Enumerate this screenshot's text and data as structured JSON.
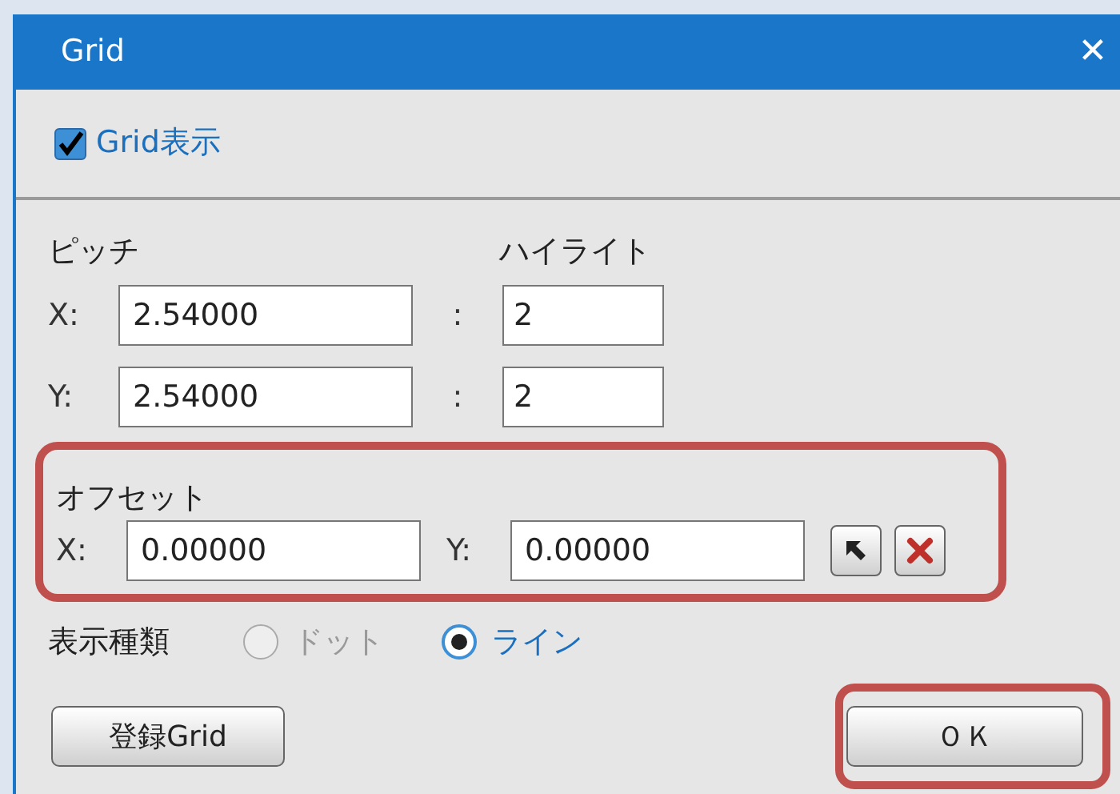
{
  "window": {
    "title": "Grid",
    "close": "✕"
  },
  "grid_display": {
    "label": "Grid表示",
    "checked": true
  },
  "pitch": {
    "label": "ピッチ",
    "highlight_label": "ハイライト",
    "rows": [
      {
        "axis": "X:",
        "value": "2.54000",
        "separator": ":",
        "highlight": "2"
      },
      {
        "axis": "Y:",
        "value": "2.54000",
        "separator": ":",
        "highlight": "2"
      }
    ]
  },
  "offset": {
    "label": "オフセット",
    "x_label": "X:",
    "x_value": "0.00000",
    "y_label": "Y:",
    "y_value": "0.00000"
  },
  "display_type": {
    "label": "表示種類",
    "options": [
      {
        "label": "ドット",
        "selected": false
      },
      {
        "label": "ライン",
        "selected": true
      }
    ]
  },
  "buttons": {
    "register": "登録Grid",
    "ok": "ＯＫ"
  }
}
